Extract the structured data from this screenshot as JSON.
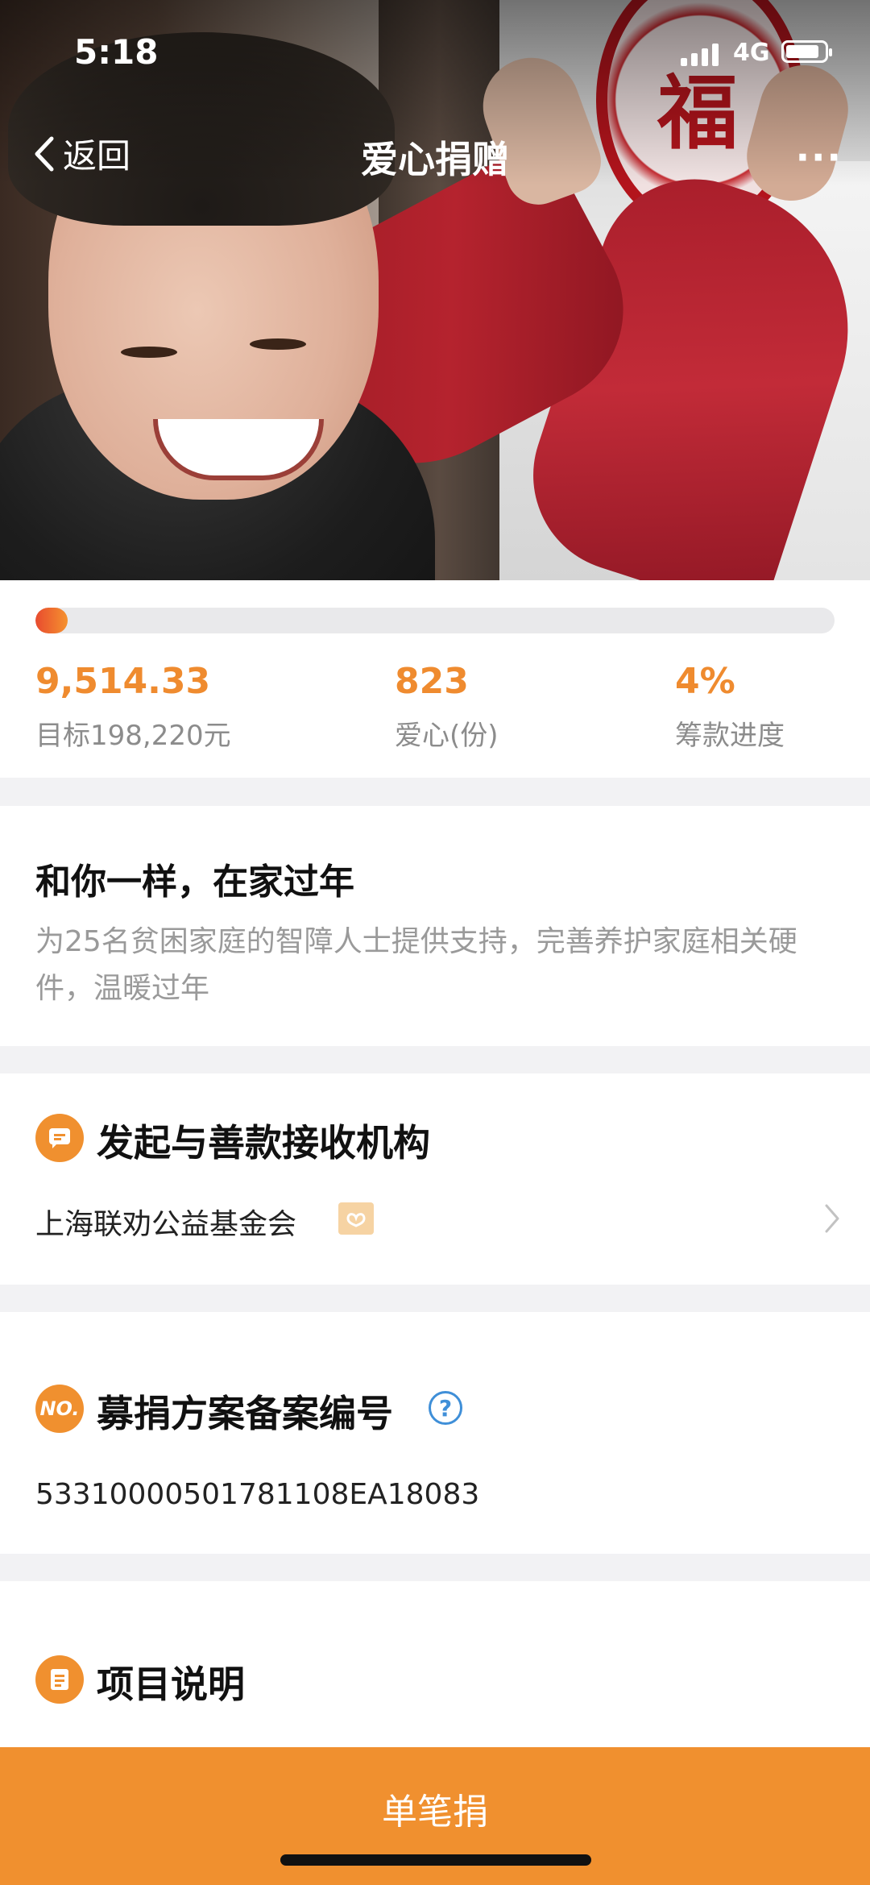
{
  "status_bar": {
    "time": "5:18",
    "network": "4G"
  },
  "nav": {
    "back_label": "返回",
    "title": "爱心捐赠",
    "more_label": "···"
  },
  "hero": {
    "charm_char": "福"
  },
  "stats": {
    "progress_fraction": 0.04,
    "raised": {
      "value": "9,514.33",
      "label": "目标198,220元"
    },
    "hearts": {
      "value": "823",
      "label": "爱心(份)"
    },
    "progress": {
      "value": "4%",
      "label": "筹款进度"
    }
  },
  "project": {
    "title": "和你一样，在家过年",
    "description": "为25名贫困家庭的智障人士提供支持，完善养护家庭相关硬件，温暖过年"
  },
  "organization": {
    "section_title": "发起与善款接收机构",
    "name": "上海联劝公益基金会"
  },
  "registration": {
    "icon_text": "NO.",
    "section_title": "募捐方案备案编号",
    "number": "53310000501781108EA18083"
  },
  "description_section": {
    "section_title": "项目说明"
  },
  "colors": {
    "accent": "#f0902f",
    "value_orange": "#ef8b2f",
    "help_blue": "#3f8fd8"
  },
  "footer": {
    "donate_label": "单笔捐"
  }
}
